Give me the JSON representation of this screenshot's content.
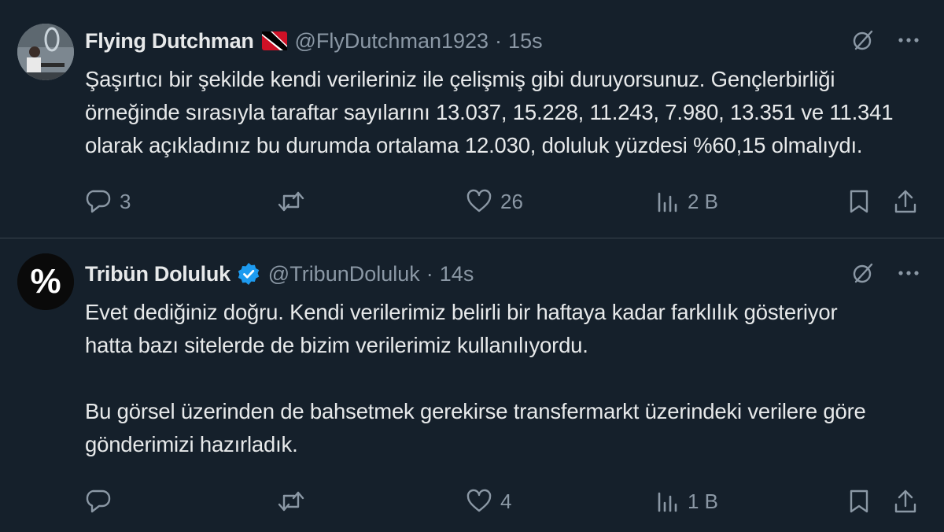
{
  "tweets": [
    {
      "name": "Flying Dutchman",
      "flag": "trinidad-and-tobago-flag",
      "handle": "@FlyDutchman1923",
      "separator": "·",
      "time": "15s",
      "lines": [
        "Şaşırtıcı bir şekilde kendi verileriniz ile çelişmiş gibi duruyorsunuz. Gençlerbirliği",
        "örneğinde sırasıyla taraftar sayılarını 13.037, 15.228, 11.243, 7.980, 13.351 ve 11.341",
        "olarak açıkladınız bu durumda ortalama 12.030, doluluk yüzdesi %60,15 olmalıydı."
      ],
      "actions": {
        "replies": "3",
        "retweets": "",
        "likes": "26",
        "views": "2 B"
      }
    },
    {
      "name": "Tribün Doluluk",
      "verified": true,
      "avatar_glyph": "%",
      "handle": "@TribunDoluluk",
      "separator": "·",
      "time": "14s",
      "paragraph1": [
        "Evet dediğiniz doğru. Kendi verilerimiz belirli bir haftaya kadar farklılık gösteriyor",
        "hatta bazı sitelerde de bizim verilerimiz kullanılıyordu."
      ],
      "paragraph2": [
        "Bu görsel üzerinden de bahsetmek gerekirse transfermarkt üzerindeki verilere göre",
        "gönderimizi hazırladık."
      ],
      "actions": {
        "replies": "",
        "retweets": "",
        "likes": "4",
        "views": "1 B"
      }
    }
  ],
  "icons": {
    "grok": "grok-icon",
    "more": "more-icon",
    "reply": "reply-icon",
    "retweet": "retweet-icon",
    "like": "like-icon",
    "views": "views-icon",
    "bookmark": "bookmark-icon",
    "share": "share-icon"
  },
  "colors": {
    "background": "#15202b",
    "text": "#e7e9ea",
    "muted": "#8b98a5",
    "verified": "#1d9bf0"
  }
}
